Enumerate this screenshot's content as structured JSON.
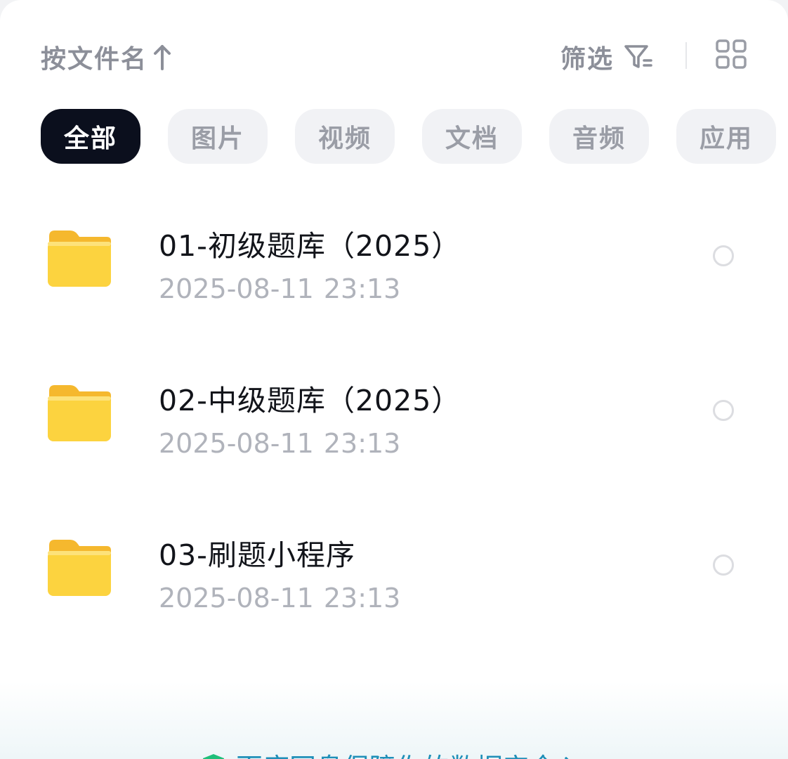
{
  "toolbar": {
    "sort_label": "按文件名",
    "filter_label": "筛选"
  },
  "categories": [
    {
      "label": "全部",
      "active": true
    },
    {
      "label": "图片",
      "active": false
    },
    {
      "label": "视频",
      "active": false
    },
    {
      "label": "文档",
      "active": false
    },
    {
      "label": "音频",
      "active": false
    },
    {
      "label": "应用",
      "active": false
    }
  ],
  "files": [
    {
      "name": "01-初级题库（2025）",
      "date": "2025-08-11",
      "time": "23:13",
      "icon": "folder-icon"
    },
    {
      "name": "02-中级题库（2025）",
      "date": "2025-08-11",
      "time": "23:13",
      "icon": "folder-icon"
    },
    {
      "name": "03-刷题小程序",
      "date": "2025-08-11",
      "time": "23:13",
      "icon": "folder-icon"
    }
  ],
  "banner": {
    "text": "百度网盘保障你的数据安全",
    "icon": "shield-icon"
  },
  "colors": {
    "active_chip_bg": "#0b0f1d",
    "chip_bg": "#f1f2f5",
    "folder_yellow": "#fcd33f",
    "muted_text": "#8c8f99"
  }
}
